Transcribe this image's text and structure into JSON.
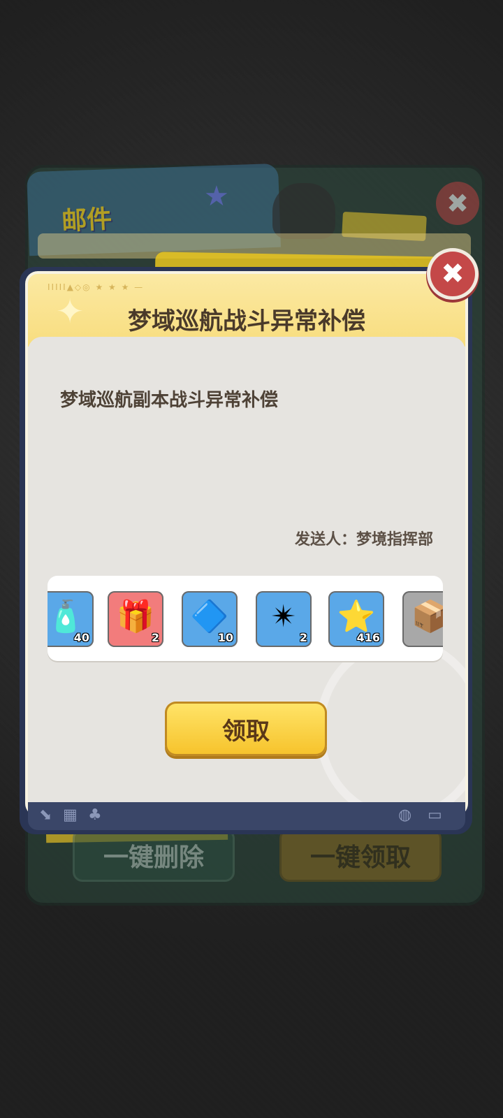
{
  "background": {
    "mail_title": "邮件",
    "delete_all_label": "一键删除",
    "claim_all_label": "一键领取"
  },
  "dialog": {
    "title": "梦域巡航战斗异常补偿",
    "body": "梦域巡航副本战斗异常补偿",
    "sender_label": "发送人：",
    "sender_name": "梦境指挥部",
    "claim_label": "领取"
  },
  "rewards": [
    {
      "name": "mystery-bottle",
      "icon": "🧴",
      "count": "40",
      "bg": "#5aa8e8"
    },
    {
      "name": "mystery-gift-box",
      "icon": "🎁",
      "count": "2",
      "bg": "#f27c7c"
    },
    {
      "name": "blue-crystal-sand",
      "icon": "🔷",
      "count": "10",
      "bg": "#5aa8e8"
    },
    {
      "name": "blue-star-badge",
      "icon": "✴",
      "count": "2",
      "bg": "#5aa8e8"
    },
    {
      "name": "gold-star-coin",
      "icon": "⭐",
      "count": "416",
      "bg": "#5aa8e8"
    },
    {
      "name": "mystery-crate",
      "icon": "📦",
      "count": "",
      "bg": "#a8a8a8"
    }
  ]
}
